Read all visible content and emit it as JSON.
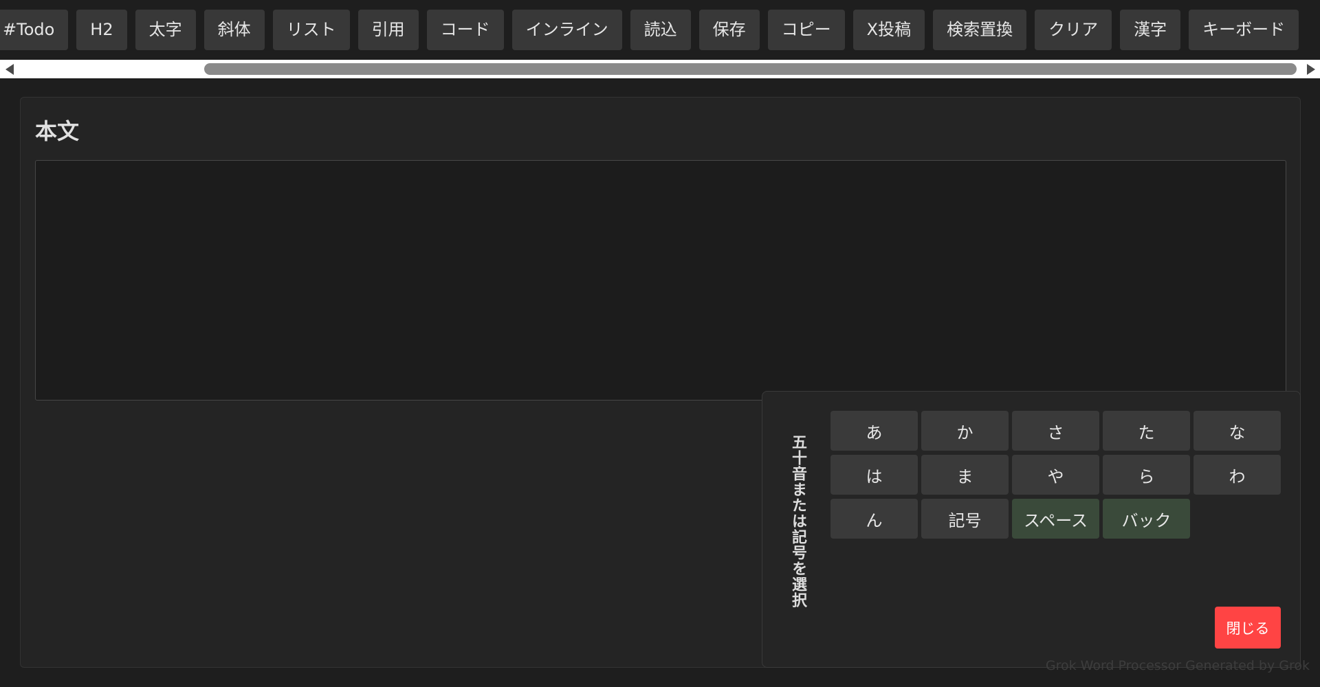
{
  "toolbar": {
    "buttons": [
      "#Todo",
      "H2",
      "太字",
      "斜体",
      "リスト",
      "引用",
      "コード",
      "インライン",
      "読込",
      "保存",
      "コピー",
      "X投稿",
      "検索置換",
      "クリア",
      "漢字",
      "キーボード"
    ]
  },
  "main": {
    "title": "本文",
    "editor_value": ""
  },
  "keyboard": {
    "label": "五十音または記号を選択",
    "keys": [
      "あ",
      "か",
      "さ",
      "た",
      "な",
      "は",
      "ま",
      "や",
      "ら",
      "わ",
      "ん",
      "記号",
      "スペース",
      "バック"
    ],
    "close_label": "閉じる"
  },
  "footer": {
    "credit": "Grok Word Processor Generated by Grok"
  },
  "colors": {
    "background": "#1e1e1e",
    "button": "#383838",
    "special_key": "#3a4a3a",
    "close_button": "#ff4444"
  }
}
